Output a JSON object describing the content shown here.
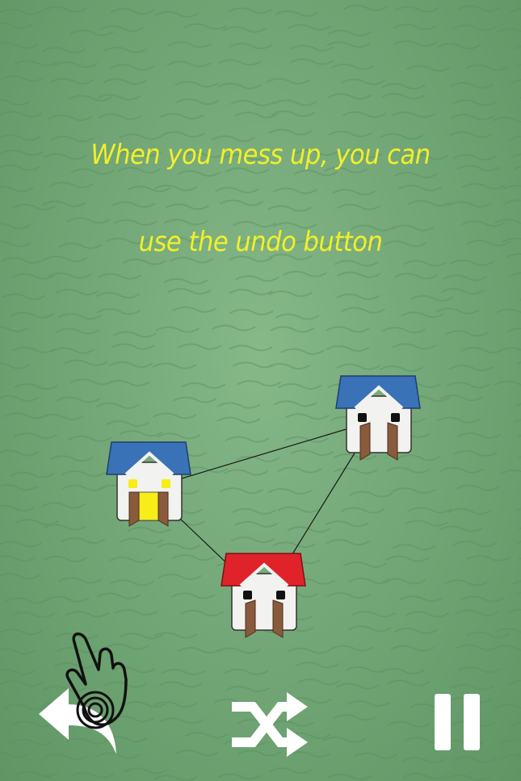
{
  "tutorial": {
    "line1": "When you mess up, you can",
    "line2": "use the undo button"
  },
  "colors": {
    "text": "#f3ef2a",
    "roof_blue": "#3a72b8",
    "roof_red": "#e0232a",
    "wall": "#f2f2f0",
    "door": "#8a5a3c",
    "door_lit": "#f7ee17",
    "window_lit": "#f7ee17",
    "window_dark": "#111111"
  },
  "houses": [
    {
      "id": "house-left",
      "roof": "blue",
      "lit": true
    },
    {
      "id": "house-right",
      "roof": "blue",
      "lit": false
    },
    {
      "id": "house-bottom",
      "roof": "red",
      "lit": false
    }
  ],
  "connections": [
    [
      "house-left",
      "house-right"
    ],
    [
      "house-left",
      "house-bottom"
    ],
    [
      "house-right",
      "house-bottom"
    ]
  ],
  "controls": [
    {
      "name": "undo",
      "icon": "undo-arrow-icon"
    },
    {
      "name": "shuffle",
      "icon": "shuffle-icon"
    },
    {
      "name": "pause",
      "icon": "pause-icon"
    }
  ],
  "pointer": {
    "icon": "tap-hand-icon"
  }
}
